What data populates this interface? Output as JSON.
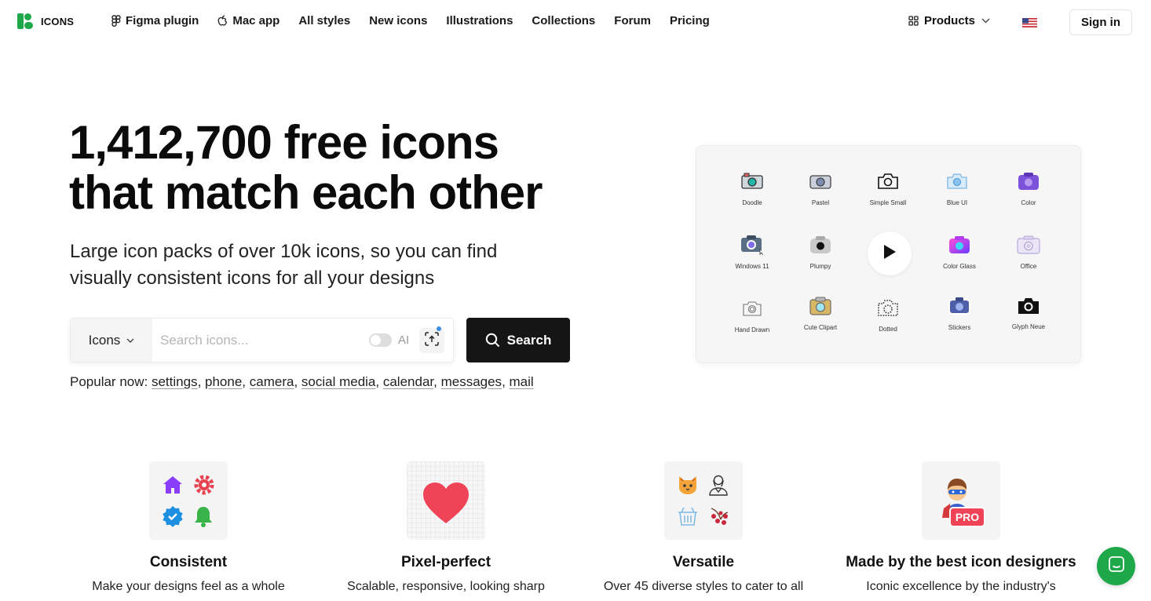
{
  "nav": {
    "logo_text": "ICONS",
    "links": [
      {
        "label": "Figma plugin",
        "icon": "figma-icon"
      },
      {
        "label": "Mac app",
        "icon": "apple-icon"
      },
      {
        "label": "All styles"
      },
      {
        "label": "New icons"
      },
      {
        "label": "Illustrations"
      },
      {
        "label": "Collections"
      },
      {
        "label": "Forum"
      },
      {
        "label": "Pricing"
      }
    ],
    "products_label": "Products",
    "language_flag": "us-flag-icon",
    "signin_label": "Sign in"
  },
  "hero": {
    "title_line1": "1,412,700 free icons",
    "title_line2": "that match each other",
    "subtitle_line1": "Large icon packs of over 10k icons, so you can find",
    "subtitle_line2": "visually consistent icons for all your designs"
  },
  "search": {
    "type_label": "Icons",
    "placeholder": "Search icons...",
    "ai_label": "AI",
    "ai_enabled": false,
    "button_label": "Search"
  },
  "popular": {
    "prefix": "Popular now:",
    "items": [
      "settings",
      "phone",
      "camera",
      "social media",
      "calendar",
      "messages",
      "mail"
    ]
  },
  "styles": [
    {
      "label": "Doodle"
    },
    {
      "label": "Pastel"
    },
    {
      "label": "Simple Small"
    },
    {
      "label": "Blue UI"
    },
    {
      "label": "Color"
    },
    {
      "label": "Windows 11"
    },
    {
      "label": "Plumpy"
    },
    {
      "label": ""
    },
    {
      "label": "Color Glass"
    },
    {
      "label": "Office"
    },
    {
      "label": "Hand Drawn"
    },
    {
      "label": "Cute Clipart"
    },
    {
      "label": "Dotted"
    },
    {
      "label": "Stickers"
    },
    {
      "label": "Glyph Neue"
    }
  ],
  "features": [
    {
      "title": "Consistent",
      "desc": "Make your designs feel as a whole"
    },
    {
      "title": "Pixel-perfect",
      "desc": "Scalable, responsive, looking sharp"
    },
    {
      "title": "Versatile",
      "desc": "Over 45 diverse styles to cater to all"
    },
    {
      "title": "Made by the best icon designers",
      "desc": "Iconic excellence by the industry's",
      "badge": "PRO"
    }
  ],
  "colors": {
    "brand_green": "#1fa84a",
    "search_button": "#151515",
    "heart_red": "#ef4458",
    "purple": "#8b3dff"
  }
}
